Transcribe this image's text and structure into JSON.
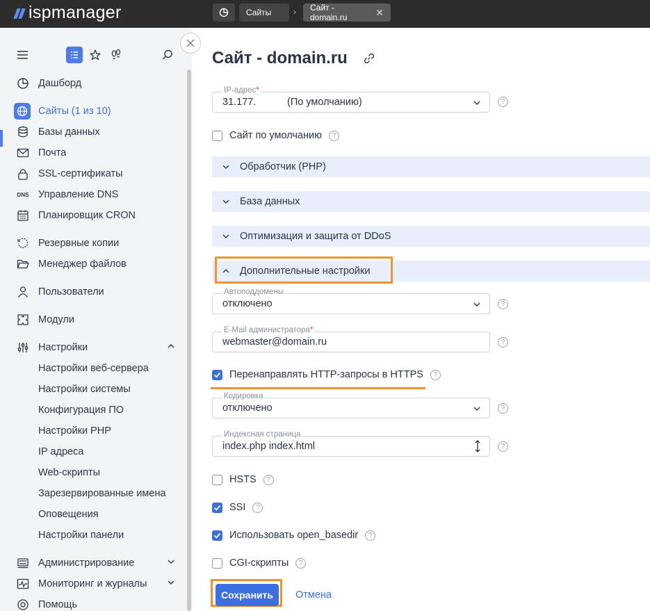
{
  "app": {
    "logo": "ispmanager"
  },
  "breadcrumbs": [
    {
      "label": "Сайты"
    },
    {
      "label": "Сайт - domain.ru",
      "close": "✕"
    }
  ],
  "sidebar": {
    "items": [
      {
        "label": "Дашборд",
        "icon": "dashboard-icon"
      },
      {
        "label": "Сайты (1 из 10)",
        "icon": "globe-icon",
        "active": true
      },
      {
        "label": "Базы данных",
        "icon": "database-icon"
      },
      {
        "label": "Почта",
        "icon": "mail-icon"
      },
      {
        "label": "SSL-сертификаты",
        "icon": "lock-icon"
      },
      {
        "label": "Управление DNS",
        "icon": "dns-icon",
        "icon_text": "DNS"
      },
      {
        "label": "Планировщик CRON",
        "icon": "calendar-icon"
      },
      {
        "label": "Резервные копии",
        "icon": "backup-icon"
      },
      {
        "label": "Менеджер файлов",
        "icon": "folder-icon"
      },
      {
        "label": "Пользователи",
        "icon": "user-icon"
      },
      {
        "label": "Модули",
        "icon": "modules-icon"
      },
      {
        "label": "Настройки",
        "icon": "settings-icon",
        "expanded": true
      },
      {
        "label": "Администрирование",
        "icon": "server-icon"
      },
      {
        "label": "Мониторинг и журналы",
        "icon": "monitoring-icon"
      },
      {
        "label": "Помощь",
        "icon": "help-icon"
      }
    ],
    "settings_sub": [
      "Настройки веб-сервера",
      "Настройки системы",
      "Конфигурация ПО",
      "Настройки PHP",
      "IP адреса",
      "Web-скрипты",
      "Зарезервированные имена",
      "Оповещения",
      "Настройки панели"
    ]
  },
  "main": {
    "title": "Сайт - domain.ru",
    "ip": {
      "label": "IP-адрес",
      "value": "31.177.",
      "note": "(По умолчанию)"
    },
    "default_site": {
      "label": "Сайт по умолчанию",
      "checked": false
    },
    "sections": [
      {
        "label": "Обработчик (PHP)"
      },
      {
        "label": "База данных"
      },
      {
        "label": "Оптимизация и защита от DDoS"
      },
      {
        "label": "Дополнительные настройки",
        "expanded": true
      }
    ],
    "autosubdomains": {
      "label": "Автоподдомены",
      "value": "отключено"
    },
    "admin_email": {
      "label": "E-Mail администратора",
      "value": "webmaster@domain.ru"
    },
    "redirect_https": {
      "label": "Перенаправлять HTTP-запросы в HTTPS",
      "checked": true
    },
    "encoding": {
      "label": "Кодировка",
      "value": "отключено"
    },
    "index_page": {
      "label": "Индексная страница",
      "value": "index.php index.html"
    },
    "hsts": {
      "label": "HSTS",
      "checked": false
    },
    "ssi": {
      "label": "SSI",
      "checked": true
    },
    "open_basedir": {
      "label": "Использовать open_basedir",
      "checked": true
    },
    "cgi": {
      "label": "CGI-скрипты",
      "checked": false
    },
    "help_glyph": "?",
    "required_mark": "*",
    "save_label": "Сохранить",
    "cancel_label": "Отмена"
  },
  "colors": {
    "accent": "#3d6fe0",
    "highlight": "#f0922e",
    "topbar": "#2c2c2c",
    "sidebar_bg": "#f3f4f6",
    "section_bg": "#e8eefb"
  }
}
